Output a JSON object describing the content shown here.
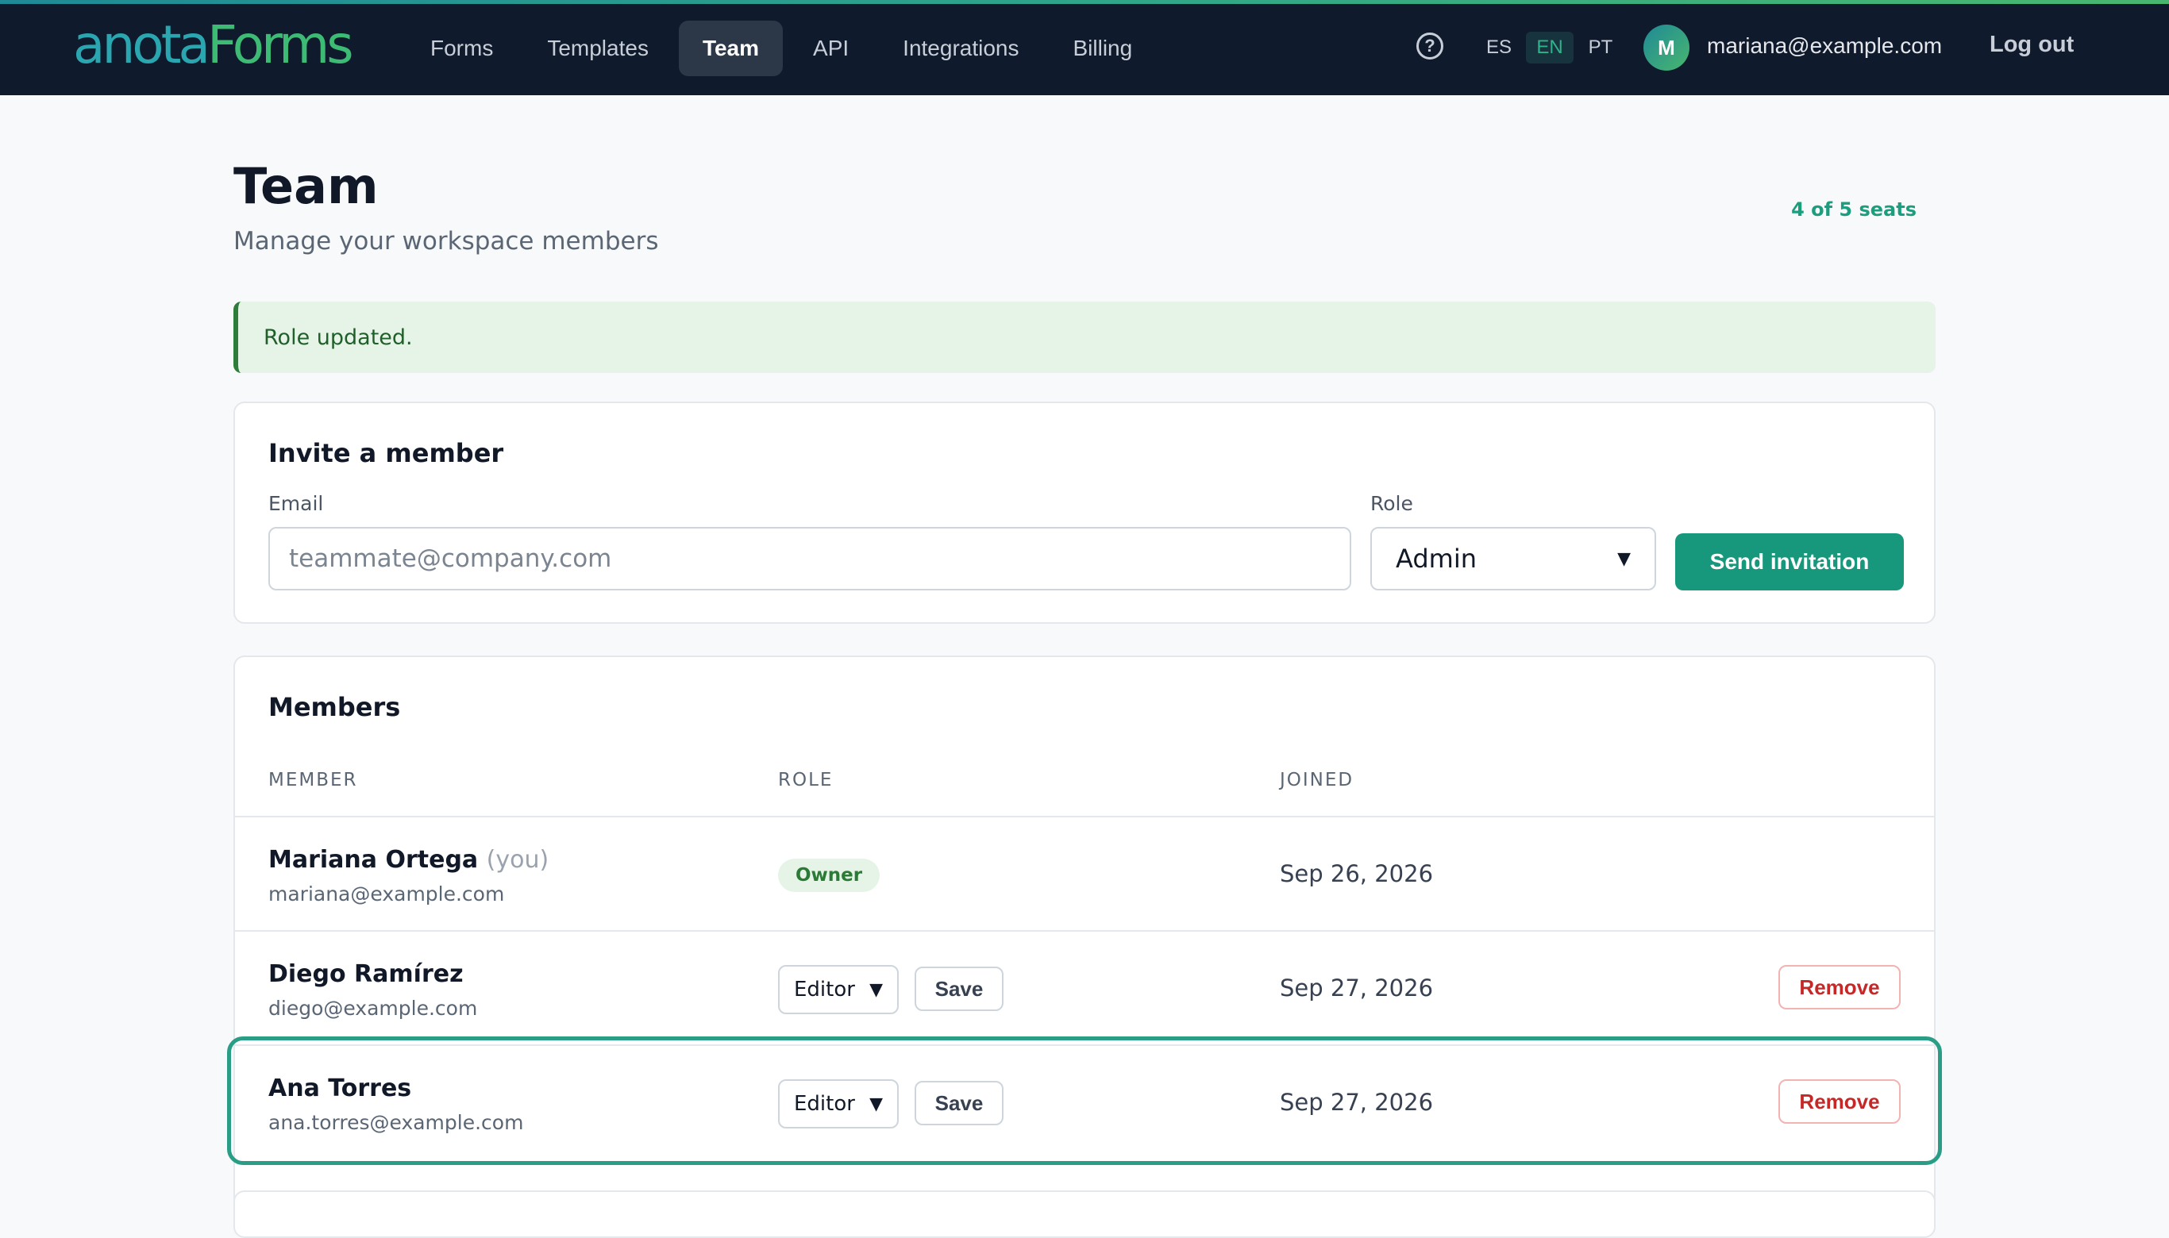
{
  "app": {
    "logo_part1": "anota",
    "logo_part2": "Forms",
    "nav": [
      {
        "label": "Forms"
      },
      {
        "label": "Templates"
      },
      {
        "label": "Team",
        "active": true
      },
      {
        "label": "API"
      },
      {
        "label": "Integrations"
      },
      {
        "label": "Billing"
      }
    ],
    "help_icon": "question-circle-icon",
    "help_glyph": "?",
    "languages": [
      "ES",
      "EN",
      "PT"
    ],
    "active_language": "EN",
    "avatar_initial": "M",
    "user_email": "mariana@example.com",
    "logout_label": "Log out"
  },
  "page": {
    "title": "Team",
    "subtitle": "Manage your workspace members",
    "seats": "4 of 5 seats",
    "alert": "Role updated."
  },
  "invite": {
    "title": "Invite a member",
    "email_label": "Email",
    "email_placeholder": "teammate@company.com",
    "email_value": "",
    "role_label": "Role",
    "role_value": "Admin",
    "send_label": "Send invitation"
  },
  "members": {
    "title": "Members",
    "columns": [
      "MEMBER",
      "ROLE",
      "JOINED"
    ],
    "rows": [
      {
        "name": "Mariana Ortega",
        "you": "(you)",
        "email": "mariana@example.com",
        "role": "Owner",
        "joined": "Sep 26, 2026"
      },
      {
        "name": "Diego Ramírez",
        "email": "diego@example.com",
        "role": "Editor",
        "save": "Save",
        "joined": "Sep 27, 2026",
        "remove": "Remove"
      },
      {
        "name": "Ana Torres",
        "email": "ana.torres@example.com",
        "role": "Editor",
        "save": "Save",
        "joined": "Sep 27, 2026",
        "remove": "Remove"
      }
    ]
  },
  "colors": {
    "nav_bg": "#0f1b2c",
    "accent": "#17987d",
    "danger": "#c62828",
    "success_bg": "#e6f4e8"
  }
}
